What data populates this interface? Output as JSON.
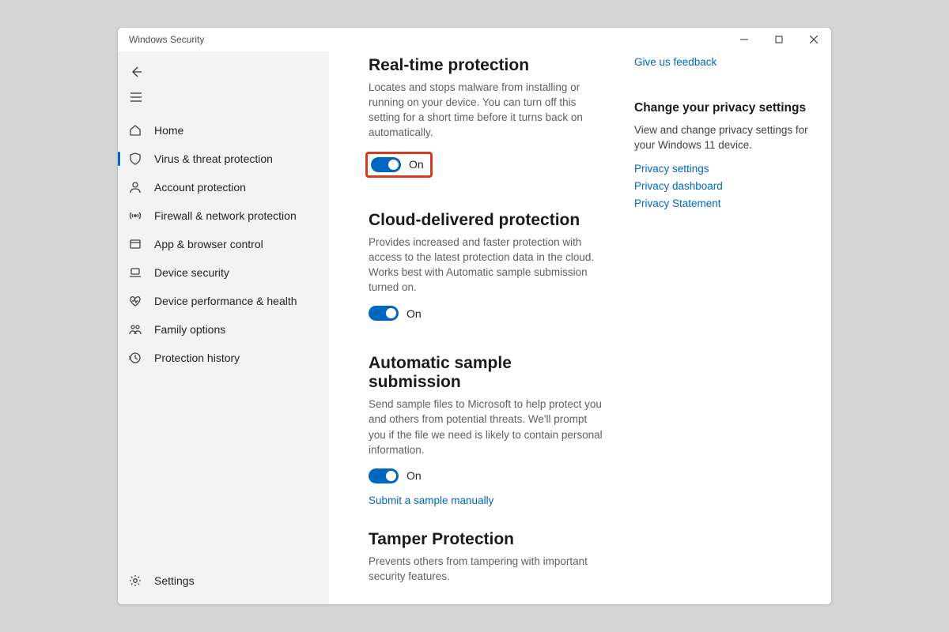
{
  "window": {
    "title": "Windows Security"
  },
  "nav": {
    "items": [
      {
        "label": "Home"
      },
      {
        "label": "Virus & threat protection"
      },
      {
        "label": "Account protection"
      },
      {
        "label": "Firewall & network protection"
      },
      {
        "label": "App & browser control"
      },
      {
        "label": "Device security"
      },
      {
        "label": "Device performance & health"
      },
      {
        "label": "Family options"
      },
      {
        "label": "Protection history"
      }
    ],
    "settings": "Settings"
  },
  "sections": {
    "realtime": {
      "title": "Real-time protection",
      "desc": "Locates and stops malware from installing or running on your device. You can turn off this setting for a short time before it turns back on automatically.",
      "state": "On"
    },
    "cloud": {
      "title": "Cloud-delivered protection",
      "desc": "Provides increased and faster protection with access to the latest protection data in the cloud. Works best with Automatic sample submission turned on.",
      "state": "On"
    },
    "sample": {
      "title": "Automatic sample submission",
      "desc": "Send sample files to Microsoft to help protect you and others from potential threats. We'll prompt you if the file we need is likely to contain personal information.",
      "state": "On",
      "link": "Submit a sample manually"
    },
    "tamper": {
      "title": "Tamper Protection",
      "desc": "Prevents others from tampering with important security features."
    }
  },
  "aside": {
    "feedback": "Give us feedback",
    "privacy_heading": "Change your privacy settings",
    "privacy_desc": "View and change privacy settings for your Windows 11 device.",
    "links": [
      "Privacy settings",
      "Privacy dashboard",
      "Privacy Statement"
    ]
  }
}
